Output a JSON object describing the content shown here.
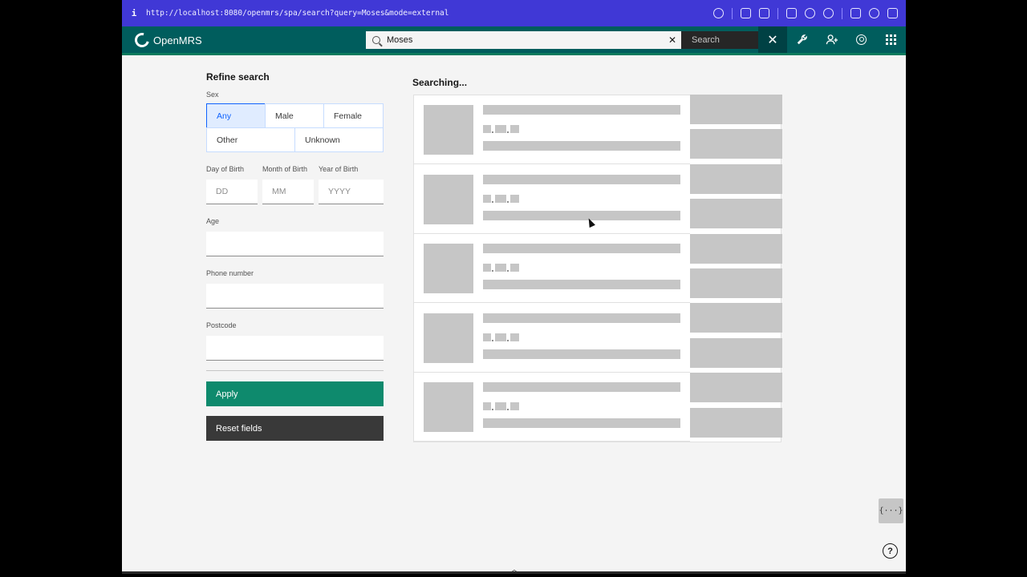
{
  "browser": {
    "info_glyph": "i",
    "url": "http://localhost:8080/openmrs/spa/search?query=Moses&mode=external"
  },
  "header": {
    "brand": "OpenMRS",
    "search_value": "Moses",
    "clear_glyph": "✕",
    "search_button": "Search",
    "close_glyph": "✕",
    "icons": [
      "wrench-icon",
      "add-user-icon",
      "user-avatar-icon",
      "app-switcher-icon"
    ]
  },
  "refine": {
    "title": "Refine search",
    "sex_label": "Sex",
    "sex_options": [
      "Any",
      "Male",
      "Female",
      "Other",
      "Unknown"
    ],
    "sex_selected": "Any",
    "dob": {
      "day_label": "Day of Birth",
      "month_label": "Month of Birth",
      "year_label": "Year of Birth",
      "day_placeholder": "DD",
      "month_placeholder": "MM",
      "year_placeholder": "YYYY"
    },
    "age_label": "Age",
    "phone_label": "Phone number",
    "postcode_label": "Postcode",
    "apply_label": "Apply",
    "reset_label": "Reset fields"
  },
  "results": {
    "status": "Searching...",
    "skeleton_rows": 5
  },
  "floating": {
    "json_button": "{···}",
    "help_glyph": "?",
    "expand_glyph": "︿"
  },
  "colors": {
    "browser_bar": "#4038d6",
    "header": "#005d5d",
    "apply": "#0e8a6d",
    "reset": "#393939",
    "skeleton": "#c6c6c6",
    "selected_blue": "#0f62fe"
  }
}
